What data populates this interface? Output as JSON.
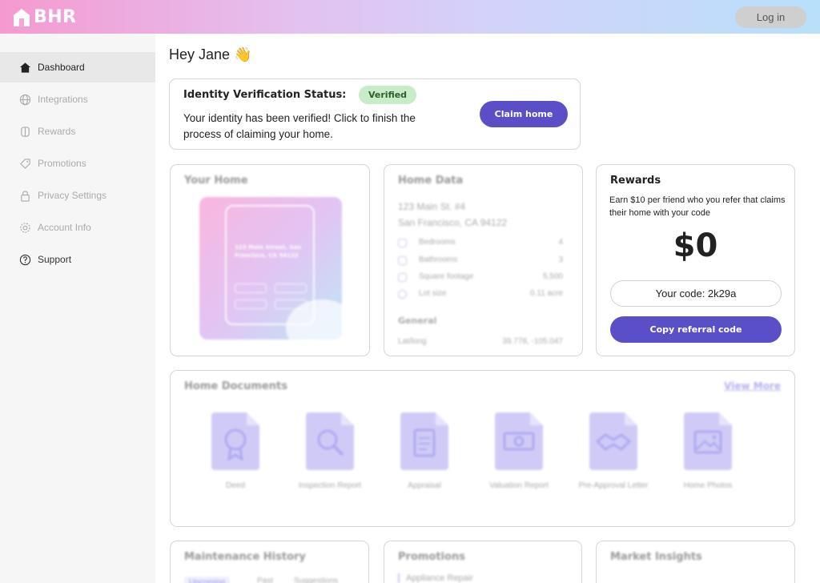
{
  "header": {
    "logo_text": "BHR",
    "login_label": "Log in"
  },
  "sidebar": {
    "items": [
      {
        "label": "Dashboard",
        "icon": "home-icon"
      },
      {
        "label": "Integrations",
        "icon": "globe-icon"
      },
      {
        "label": "Rewards",
        "icon": "gift-icon"
      },
      {
        "label": "Promotions",
        "icon": "tag-icon"
      },
      {
        "label": "Privacy Settings",
        "icon": "lock-icon"
      },
      {
        "label": "Account Info",
        "icon": "gear-icon"
      },
      {
        "label": "Support",
        "icon": "help-icon"
      }
    ]
  },
  "main": {
    "greeting": "Hey Jane 👋",
    "verification": {
      "title": "Identity Verification Status:",
      "badge": "Verified",
      "message": "Your identity has been verified! Click to finish the process of claiming your home.",
      "button": "Claim home"
    },
    "your_home": {
      "title": "Your Home",
      "image_address": "123 Main Street, San Francisco, CA 94122"
    },
    "home_data": {
      "title": "Home Data",
      "address_line1": "123 Main St. #4",
      "address_line2": "San Francisco, CA 94122",
      "rows": [
        {
          "label": "Bedrooms",
          "value": "4"
        },
        {
          "label": "Bathrooms",
          "value": "3"
        },
        {
          "label": "Square footage",
          "value": "5,500"
        },
        {
          "label": "Lot size",
          "value": "0.11 acre"
        }
      ],
      "general_title": "General",
      "general_rows": [
        {
          "label": "Lat/long",
          "value": "39.778, -105.047"
        }
      ]
    },
    "rewards": {
      "title": "Rewards",
      "description": "Earn $10 per friend who you refer that claims their home with your code",
      "amount": "$0",
      "code_label": "Your code: 2k29a",
      "copy_button": "Copy referral code"
    },
    "documents": {
      "title": "Home Documents",
      "view_more": "View More",
      "items": [
        {
          "label": "Deed",
          "icon": "seal-icon"
        },
        {
          "label": "Inspection Report",
          "icon": "magnifier-icon"
        },
        {
          "label": "Appraisal",
          "icon": "clipboard-icon"
        },
        {
          "label": "Valuation Report",
          "icon": "money-icon"
        },
        {
          "label": "Pre-Approval Letter",
          "icon": "handshake-icon"
        },
        {
          "label": "Home Photos",
          "icon": "photo-icon"
        }
      ]
    },
    "maintenance": {
      "title": "Maintenance History",
      "tabs": [
        "Upcoming",
        "Past",
        "Suggestions"
      ]
    },
    "promotions": {
      "title": "Promotions",
      "first_item": "Appliance Repair"
    },
    "market": {
      "title": "Market Insights"
    }
  },
  "colors": {
    "accent": "#5b4fc7",
    "verified_bg": "#c8ebc8",
    "doc_icon": "#cfcbf6"
  }
}
